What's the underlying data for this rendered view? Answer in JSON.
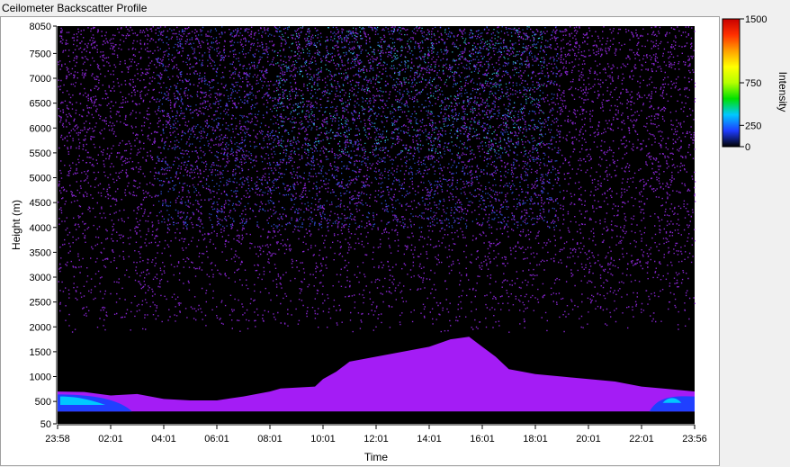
{
  "window_title": "Ceilometer Backscatter Profile",
  "chart_data": {
    "type": "heatmap",
    "title": "Ceilometer Backscatter Profile",
    "xlabel": "Time",
    "ylabel": "Height (m)",
    "x_tick_labels": [
      "23:58",
      "02:01",
      "04:01",
      "06:01",
      "08:01",
      "10:01",
      "12:01",
      "14:01",
      "16:01",
      "18:01",
      "20:01",
      "22:01",
      "23:56"
    ],
    "y_ticks": [
      50,
      500,
      1000,
      1500,
      2000,
      2500,
      3000,
      3500,
      4000,
      4500,
      5000,
      5500,
      6000,
      6500,
      7000,
      7500,
      8050
    ],
    "ylim": [
      50,
      8050
    ],
    "colorbar": {
      "label": "Intensity",
      "ticks": [
        0,
        250,
        750,
        1500
      ],
      "range": [
        0,
        1500
      ],
      "colors": [
        "#000000",
        "#1e3cff",
        "#00c8ff",
        "#00e000",
        "#b4ff00",
        "#ffff00",
        "#ffa000",
        "#ff3000",
        "#c80000"
      ]
    },
    "layers": {
      "noise_background": "#9b2bef",
      "boundary_layer": "#a41cf5",
      "near_surface_high": [
        "#2040ff",
        "#00c8ff"
      ]
    },
    "boundary_layer_top_m": {
      "times_h": [
        0,
        1,
        2,
        3,
        4,
        5,
        6,
        7,
        8,
        8.4,
        9,
        9.7,
        10,
        10.5,
        11,
        12,
        13,
        14,
        14.8,
        15.5,
        16,
        16.5,
        17,
        17.5,
        18,
        19,
        20,
        21,
        22,
        23,
        24
      ],
      "height_m": [
        700,
        690,
        620,
        650,
        550,
        520,
        520,
        600,
        700,
        760,
        780,
        800,
        950,
        1100,
        1300,
        1400,
        1500,
        1600,
        1750,
        1800,
        1600,
        1400,
        1150,
        1100,
        1050,
        1000,
        950,
        900,
        800,
        750,
        700
      ]
    },
    "noise_top_m": 8050,
    "clear_layer_top_m": 2300
  }
}
